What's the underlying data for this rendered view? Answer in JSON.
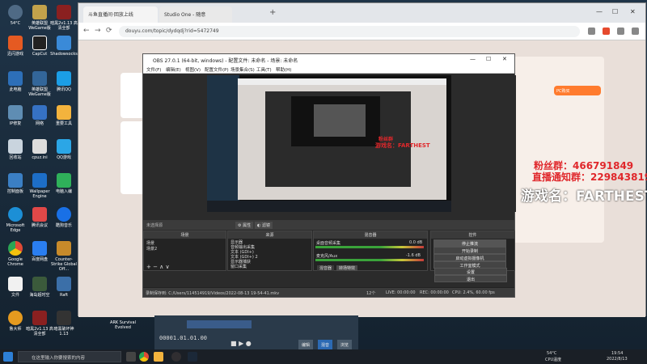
{
  "desktop": {
    "icons": [
      {
        "label": "此电脑",
        "color": "#2d6fb8"
      },
      {
        "label": "回收站",
        "color": "#5f8db3"
      },
      {
        "label": "控制面板",
        "color": "#3b7fc4"
      },
      {
        "label": "Microsoft Edge",
        "color": "#1c8fd6"
      },
      {
        "label": "Google Chrome",
        "color": "#e04a35"
      },
      {
        "label": "文件",
        "color": "#f1f1f1"
      },
      {
        "label": "鲁大师",
        "color": "#e59a1f"
      }
    ],
    "icons_col2": [
      {
        "label": "英雄联盟 WeGame版",
        "color": "#c2a24b"
      },
      {
        "label": "CapCut",
        "color": "#222"
      },
      {
        "label": "英雄联盟WeGame版",
        "color": "#336699"
      },
      {
        "label": "网络",
        "color": "#3672c4"
      },
      {
        "label": "cpuz.ini",
        "color": "#dddddd"
      },
      {
        "label": "Wallpaper Engine",
        "color": "#1d6ec7"
      },
      {
        "label": "腾讯会议",
        "color": "#e04848"
      },
      {
        "label": "百度网盘",
        "color": "#2a7ef0"
      },
      {
        "label": "海岛超时空",
        "color": "#3b5a3b"
      },
      {
        "label": "暗黑2v1.13 高清全部",
        "color": "#8a2020"
      }
    ],
    "icons_col3": [
      {
        "label": "暗黑2v1.13 高清全部",
        "color": "#8a2020"
      },
      {
        "label": "Shadowsocks",
        "color": "#3a8ad8"
      },
      {
        "label": "腾讯QQ",
        "color": "#1b9ee6"
      },
      {
        "label": "重要工具",
        "color": "#f3b33d"
      },
      {
        "label": "QQ游戏",
        "color": "#2ba6e6"
      },
      {
        "label": "电脑入编",
        "color": "#2fb05a"
      },
      {
        "label": "酷狗音乐",
        "color": "#1970e6"
      },
      {
        "label": "Counter-Strike Global Off...",
        "color": "#c78a2a"
      },
      {
        "label": "Raft",
        "color": "#3b6fa8"
      },
      {
        "label": "暗黑破坏神 1.13",
        "color": "#333"
      }
    ],
    "top_labels": [
      "ARK Survival Evolved"
    ]
  },
  "browser": {
    "tab1": "斗鱼直播间·回放上线",
    "tab2": "Studio One - 随意",
    "url": "douyu.com/topic/dydqdj?rid=5472749",
    "nav": {
      "back": "←",
      "forward": "→",
      "reload": "⟳"
    }
  },
  "stream_overlay": {
    "fans_line": "粉丝群：466791849",
    "live_notice": "直播通知群：229843819",
    "game_name": "游戏名：FARTHEST",
    "preview_game_name": "游戏名：FARTHEST"
  },
  "obs": {
    "title": "OBS 27.0.1 (64-bit, windows) - 配置文件: 未命名 - 场景: 未命名",
    "menu": [
      "文件(F)",
      "编辑(E)",
      "视图(V)",
      "配置文件(P)",
      "场景集合(S)",
      "工具(T)",
      "帮助(H)"
    ],
    "source_label": "未选择源",
    "prop_btn": "属性",
    "filter_btn": "滤镜",
    "panels": {
      "scenes": "场景",
      "sources": "来源",
      "mixer": "混音器",
      "transitions": "场景过渡",
      "controls": "控件"
    },
    "scenes": [
      "场景",
      "场景2"
    ],
    "sources": [
      "显示器",
      "音频输出采集",
      "文本 (GDI+)",
      "文本 (GDI+) 2",
      "显示器捕获",
      "窗口采集"
    ],
    "mixer": [
      {
        "name": "桌面音频采集",
        "db": "0.0 dB"
      },
      {
        "name": "麦克风/Aux",
        "db": "-1.6 dB"
      }
    ],
    "controls": [
      "停止推流",
      "开始录制",
      "启动虚拟摄像机",
      "工作室模式",
      "设置",
      "退出"
    ],
    "tabs": [
      "混音器",
      "转场特效"
    ],
    "status": {
      "recording_path": "录制保存到: C:/Users/114514919/Videos/2022-08-13 19-54-41.mkv",
      "live": "LIVE: 00:00:00",
      "rec": "REC: 00:00:00",
      "cpu": "CPU: 2.4%, 60.00 fps",
      "dropped": "12个"
    }
  },
  "studio_strip": {
    "timecode": "00001.01.01.00",
    "tabs": [
      "编辑",
      "混音",
      "浏览"
    ]
  },
  "taskbar": {
    "search_placeholder": "在这里输入你要搜索的内容",
    "weather_temp": "54°C",
    "weather_label": "CPU温度",
    "time": "19:54",
    "date": "2022/8/13"
  },
  "colors": {
    "overlay_red": "#e0272b",
    "obs_bg": "#2b2b2b",
    "page_bg": "#e9dfd9"
  }
}
